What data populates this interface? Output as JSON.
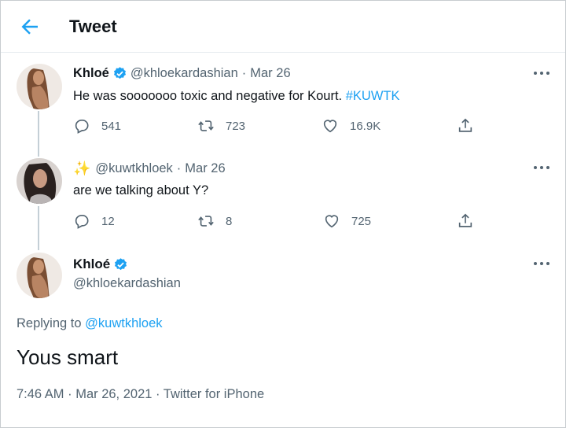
{
  "header": {
    "title": "Tweet"
  },
  "colors": {
    "accent": "#1da1f2",
    "muted": "#536471",
    "text": "#0f1419"
  },
  "tweets": [
    {
      "name": "Khloé",
      "handle": "@khloekardashian",
      "separator": "·",
      "date": "Mar 26",
      "text": "He was sooooooo toxic and negative for Kourt.",
      "hashtag": "#KUWTK",
      "replies": "541",
      "retweets": "723",
      "likes": "16.9K"
    },
    {
      "emoji": "✨",
      "handle": "@kuwtkhloek",
      "separator": "·",
      "date": "Mar 26",
      "text": "are we talking about Y?",
      "replies": "12",
      "retweets": "8",
      "likes": "725"
    }
  ],
  "main": {
    "name": "Khloé",
    "handle": "@khloekardashian",
    "replying_label": "Replying to",
    "replying_to": "@kuwtkhloek",
    "text": "Yous smart",
    "meta": "7:46 AM · Mar 26, 2021 · Twitter for iPhone"
  }
}
